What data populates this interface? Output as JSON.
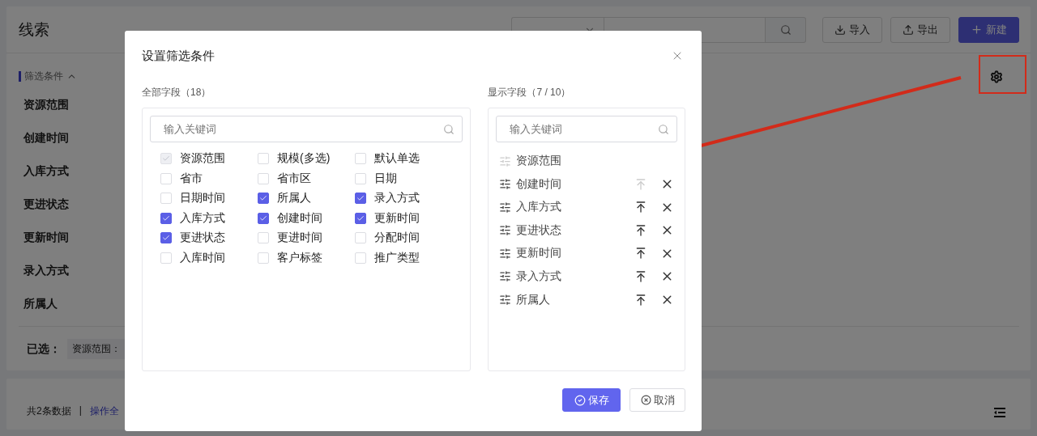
{
  "page": {
    "title": "线索",
    "search": {
      "kind": "name-search"
    },
    "buttons": [
      {
        "label": "导入",
        "kind": "import"
      },
      {
        "label": "导出",
        "kind": "export"
      },
      {
        "label": "新建",
        "kind": "create"
      }
    ],
    "filter": {
      "title": "筛选条件",
      "expanded": true,
      "rows": [
        "资源范围",
        "创建时间",
        "入库方式",
        "更进状态",
        "更新时间",
        "录入方式",
        "所属人"
      ],
      "selected_label": "已选：",
      "tags": [
        "资源范围："
      ]
    },
    "list": {
      "count": "共2条数据",
      "separator": "|",
      "link": "操作全"
    }
  },
  "dialog": {
    "title": "设置筛选条件",
    "all_fields": {
      "label": "全部字段（18）",
      "placeholder": "输入关键词",
      "items": [
        {
          "label": "资源范围",
          "checked": true,
          "disabled": true
        },
        {
          "label": "规模(多选)",
          "checked": false,
          "disabled": false
        },
        {
          "label": "默认单选",
          "checked": false,
          "disabled": false
        },
        {
          "label": "省市",
          "checked": false,
          "disabled": false
        },
        {
          "label": "省市区",
          "checked": false,
          "disabled": false
        },
        {
          "label": "日期",
          "checked": false,
          "disabled": false
        },
        {
          "label": "日期时间",
          "checked": false,
          "disabled": false
        },
        {
          "label": "所属人",
          "checked": true,
          "disabled": false
        },
        {
          "label": "录入方式",
          "checked": true,
          "disabled": false
        },
        {
          "label": "入库方式",
          "checked": true,
          "disabled": false
        },
        {
          "label": "创建时间",
          "checked": true,
          "disabled": false
        },
        {
          "label": "更新时间",
          "checked": true,
          "disabled": false
        },
        {
          "label": "更进状态",
          "checked": true,
          "disabled": false
        },
        {
          "label": "更进时间",
          "checked": false,
          "disabled": false
        },
        {
          "label": "分配时间",
          "checked": false,
          "disabled": false
        },
        {
          "label": "入库时间",
          "checked": false,
          "disabled": false
        },
        {
          "label": "客户标签",
          "checked": false,
          "disabled": false
        },
        {
          "label": "推广类型",
          "checked": false,
          "disabled": false
        }
      ]
    },
    "shown_fields": {
      "label": "显示字段（7 / 10）",
      "placeholder": "输入关键词",
      "items": [
        {
          "label": "资源范围",
          "fixed": true
        },
        {
          "label": "创建时间",
          "fixed": false,
          "top_disabled": true
        },
        {
          "label": "入库方式",
          "fixed": false,
          "top_disabled": false
        },
        {
          "label": "更进状态",
          "fixed": false,
          "top_disabled": false
        },
        {
          "label": "更新时间",
          "fixed": false,
          "top_disabled": false
        },
        {
          "label": "录入方式",
          "fixed": false,
          "top_disabled": false
        },
        {
          "label": "所属人",
          "fixed": false,
          "top_disabled": false
        }
      ]
    },
    "buttons": [
      {
        "label": "保存",
        "kind": "primary"
      },
      {
        "label": "取消",
        "kind": "default"
      }
    ]
  }
}
